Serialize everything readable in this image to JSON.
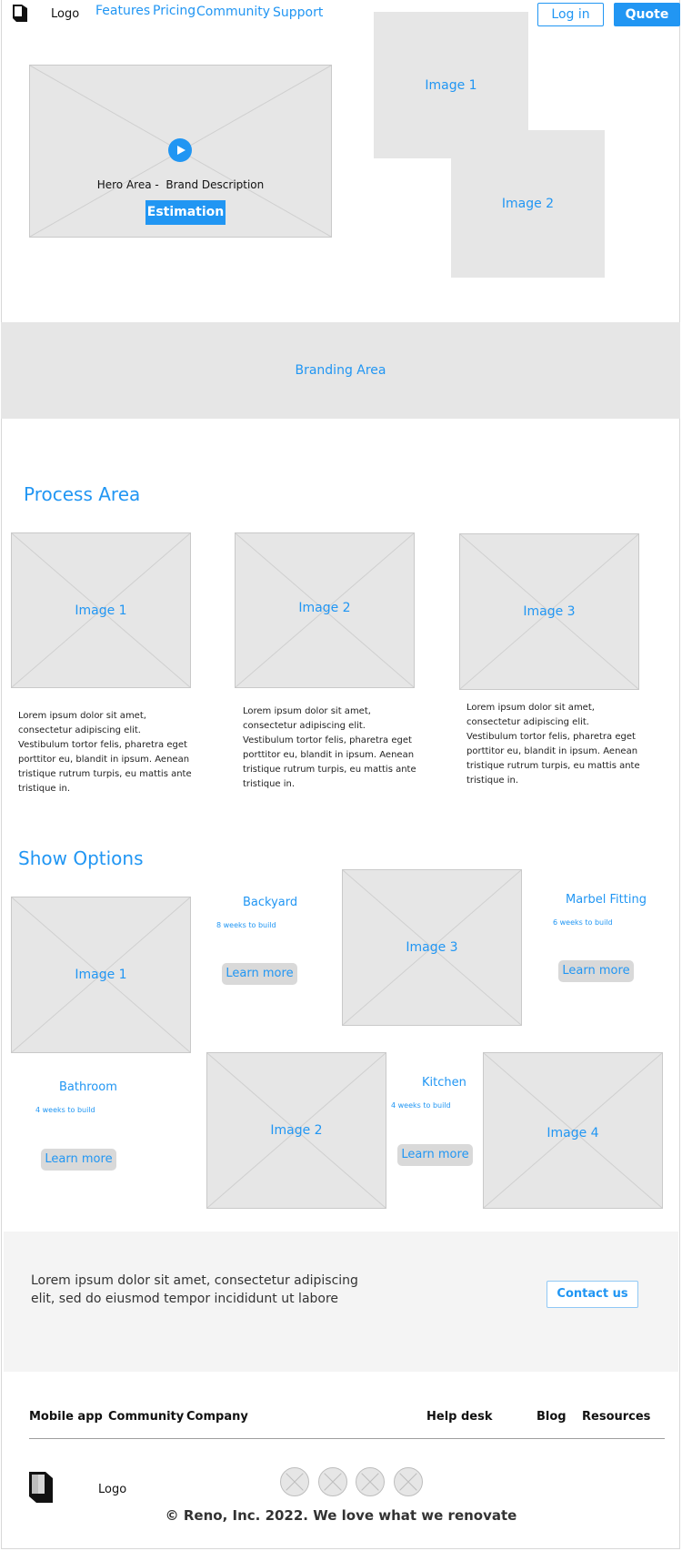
{
  "header": {
    "logo_text": "Logo",
    "nav": [
      "Features",
      "Pricing",
      "Community",
      "Support"
    ],
    "login_label": "Log in",
    "quote_label": "Quote"
  },
  "hero": {
    "description": "Hero Area -  Brand Description",
    "cta_label": "Estimation",
    "image1_label": "Image 1",
    "image2_label": "Image 2"
  },
  "branding": {
    "label": "Branding Area"
  },
  "process": {
    "title": "Process Area",
    "items": [
      {
        "image_label": "Image 1",
        "text": "Lorem ipsum dolor sit amet, consectetur adipiscing elit. Vestibulum tortor felis, pharetra eget porttitor eu, blandit in ipsum. Aenean tristique rutrum turpis, eu mattis ante tristique in."
      },
      {
        "image_label": "Image 2",
        "text": "Lorem ipsum dolor sit amet, consectetur adipiscing elit. Vestibulum tortor felis, pharetra eget porttitor eu, blandit in ipsum. Aenean tristique rutrum turpis, eu mattis ante tristique in."
      },
      {
        "image_label": "Image 3",
        "text": "Lorem ipsum dolor sit amet, consectetur adipiscing elit. Vestibulum tortor felis, pharetra eget porttitor eu, blandit in ipsum. Aenean tristique rutrum turpis, eu mattis ante tristique in."
      }
    ]
  },
  "options": {
    "title": "Show Options",
    "learn_more_label": "Learn more",
    "items": [
      {
        "title": "Backyard",
        "subtitle": "8 weeks to build",
        "image_label": "Image 1"
      },
      {
        "title": "Marbel Fitting",
        "subtitle": "6 weeks to build",
        "image_label": "Image 3"
      },
      {
        "title": "Bathroom",
        "subtitle": "4 weeks to build",
        "image_label": "Image 2"
      },
      {
        "title": "Kitchen",
        "subtitle": "4 weeks to build",
        "image_label": "Image 4"
      }
    ]
  },
  "cta_band": {
    "text": "Lorem ipsum dolor sit amet, consectetur adipiscing elit, sed do eiusmod tempor incididunt ut labore",
    "contact_label": "Contact us"
  },
  "footer": {
    "links": [
      "Mobile app",
      "Community",
      "Company",
      "Help desk",
      "Blog",
      "Resources"
    ],
    "logo_text": "Logo",
    "copyright": "© Reno, Inc. 2022. We love what we renovate"
  },
  "colors": {
    "accent": "#2196f3",
    "placeholder": "#e6e6e6",
    "band": "#f4f4f4"
  }
}
